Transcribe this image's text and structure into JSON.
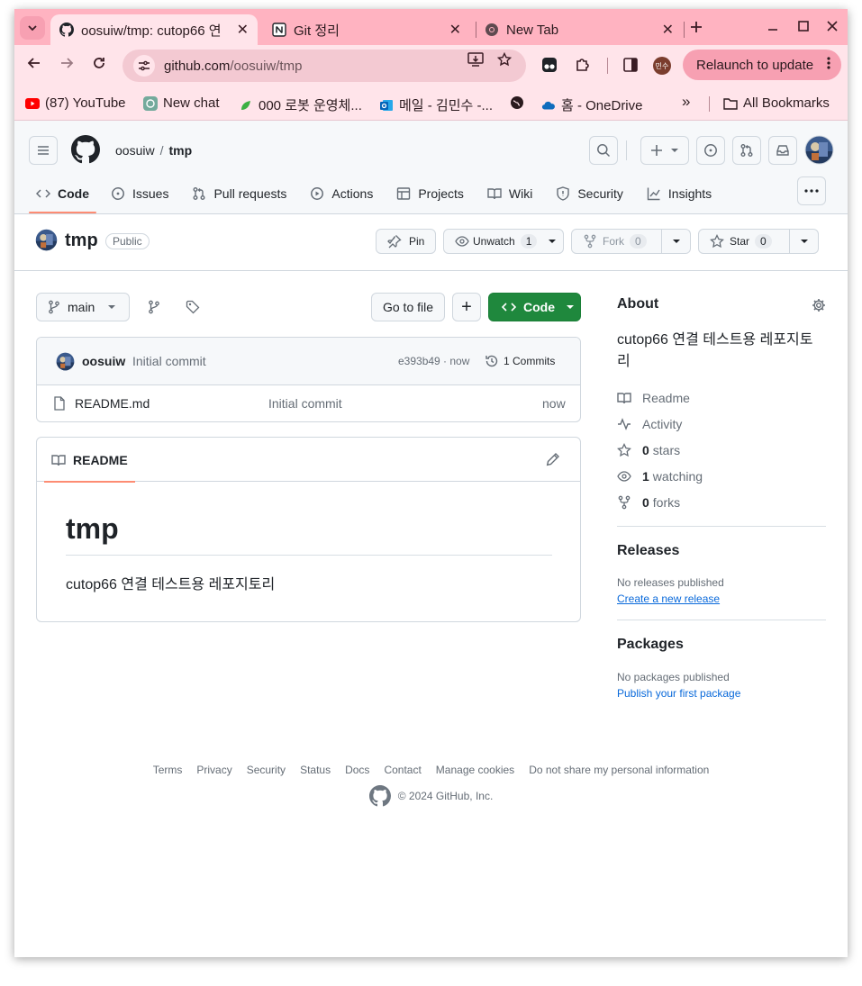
{
  "browser": {
    "tabs": [
      {
        "title": "oosuiw/tmp: cutop66 연",
        "icon": "github-icon",
        "active": true
      },
      {
        "title": "Git 정리",
        "icon": "notion-icon",
        "active": false
      },
      {
        "title": "New Tab",
        "icon": "chrome-icon",
        "active": false
      }
    ],
    "url_host": "github.com",
    "url_path": "/oosuiw/tmp",
    "profile_label": "민수",
    "relaunch_label": "Relaunch to update",
    "bookmarks": [
      {
        "label": "(87) YouTube",
        "icon": "youtube-icon"
      },
      {
        "label": "New chat",
        "icon": "chatgpt-icon"
      },
      {
        "label": "000 로봇 운영체...",
        "icon": "leaf-icon"
      },
      {
        "label": "메일 - 김민수 -...",
        "icon": "outlook-icon"
      },
      {
        "label": "",
        "icon": "globe-icon"
      },
      {
        "label": "홈 - OneDrive",
        "icon": "onedrive-icon"
      }
    ],
    "all_bookmarks_label": "All Bookmarks",
    "overflow_label": "»"
  },
  "github": {
    "owner": "oosuiw",
    "crumb_sep": "/",
    "repo": "tmp",
    "nav": [
      "Code",
      "Issues",
      "Pull requests",
      "Actions",
      "Projects",
      "Wiki",
      "Security",
      "Insights"
    ],
    "visibility": "Public",
    "actions": {
      "pin": "Pin",
      "unwatch": "Unwatch",
      "watch_count": "1",
      "fork": "Fork",
      "fork_count": "0",
      "star": "Star",
      "star_count": "0"
    },
    "branch": "main",
    "go_to_file": "Go to file",
    "add_label": "+",
    "code_btn": "Code",
    "commit": {
      "author": "oosuiw",
      "message": "Initial commit",
      "sha_time": "e393b49 · now",
      "commits_label": "1 Commits"
    },
    "files": [
      {
        "name": "README.md",
        "message": "Initial commit",
        "age": "now"
      }
    ],
    "readme": {
      "tab_label": "README",
      "heading": "tmp",
      "body": "cutop66 연결 테스트용 레포지토리"
    },
    "about": {
      "title": "About",
      "description": "cutop66 연결 테스트용 레포지토리",
      "readme_link": "Readme",
      "activity_link": "Activity",
      "stars_count": "0",
      "stars_label": "stars",
      "watching_count": "1",
      "watching_label": "watching",
      "forks_count": "0",
      "forks_label": "forks"
    },
    "releases": {
      "title": "Releases",
      "empty": "No releases published",
      "link": "Create a new release"
    },
    "packages": {
      "title": "Packages",
      "empty": "No packages published",
      "link": "Publish your first package"
    },
    "footer": {
      "links": [
        "Terms",
        "Privacy",
        "Security",
        "Status",
        "Docs",
        "Contact",
        "Manage cookies",
        "Do not share my personal information"
      ],
      "copyright": "© 2024 GitHub, Inc."
    }
  }
}
